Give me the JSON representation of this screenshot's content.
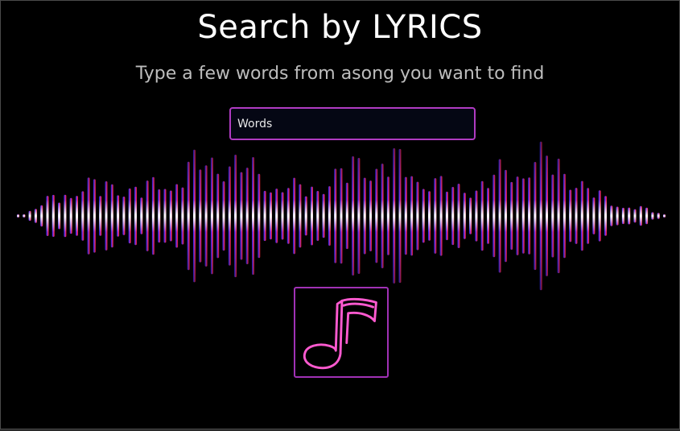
{
  "header": {
    "title": "Search by LYRICS",
    "subtitle": "Type a few words from asong you want to find"
  },
  "search": {
    "placeholder": "Words",
    "value": ""
  },
  "search_button": {
    "icon": "music-note-icon",
    "color": "#ff5ad0"
  },
  "waveform": {
    "colors": [
      "#2f2bff",
      "#5a2de0",
      "#b12ec8",
      "#e02a7a",
      "#ff1e2a"
    ],
    "center_color": "#ffffff"
  }
}
